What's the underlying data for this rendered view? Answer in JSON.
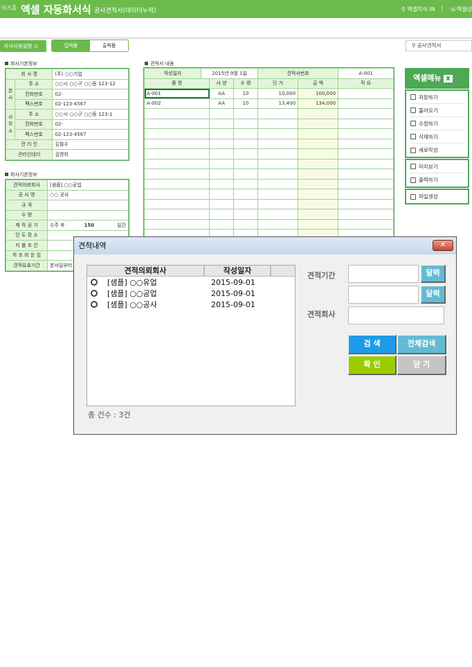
{
  "header": {
    "brand_small": "비즈폼",
    "brand": "엑셀 자동화서식",
    "subtitle": "공사견적서(데이터누적)",
    "knowledge": "엑셀지식 IN",
    "sep": "|",
    "consult": "엑셀상담"
  },
  "toolbar": {
    "guide": "서식사용설명",
    "tab_input": "입력폼",
    "tab_output": "출력폼",
    "search": "공사견적서"
  },
  "company": {
    "section": "회사기본정보",
    "name_label": "회 사 명",
    "name": "(주) ○○기업",
    "hq_label": "본 사",
    "office_label": "사 무 소",
    "addr_label": "주 소",
    "phone_label": "전화번호",
    "fax_label": "팩스번호",
    "hq_addr": "○○시 ○○구 ○○동 123-12",
    "hq_phone": "02-",
    "hq_fax": "02-123-4567",
    "of_addr": "○○시 ○○구 ○○동 123-1",
    "of_phone": "02-",
    "of_fax": "02-123-4567",
    "mgr_label": "관 리 인",
    "mgr": "김철수",
    "deputy_label": "관리인대리",
    "deputy": "김영희"
  },
  "project": {
    "section": "회사기본정보",
    "rows": [
      {
        "label": "견적의뢰회사",
        "value": "[샘플] ○○공업"
      },
      {
        "label": "공 사 명",
        "value": "○○ 공사"
      },
      {
        "label": "규 격",
        "value": ""
      },
      {
        "label": "수 량",
        "value": ""
      },
      {
        "label": "제 작 공 기",
        "value": "수주 후",
        "num": "150",
        "unit": "일간"
      },
      {
        "label": "인 도 장 소",
        "value": ""
      },
      {
        "label": "지 불 조 건",
        "value": ""
      },
      {
        "label": "하 조 비 운 임",
        "value": ""
      },
      {
        "label": "견적유효기간",
        "value": "본서일부터"
      }
    ]
  },
  "estimate": {
    "section": "견적서 내용",
    "date_label": "작성일자",
    "date": "2015년 9월 1일",
    "no_label": "견적서번호",
    "no": "A-001",
    "headers": [
      "품 명",
      "사 양",
      "수 량",
      "단 가",
      "금 액",
      "적 요"
    ],
    "rows": [
      [
        "A-001",
        "AA",
        "10",
        "10,000",
        "100,000",
        ""
      ],
      [
        "A-002",
        "AA",
        "10",
        "13,400",
        "134,000",
        ""
      ]
    ]
  },
  "menu": {
    "title": "엑셀메뉴",
    "items": [
      "저장하기",
      "불러오기",
      "수정하기",
      "삭제하기",
      "새로작성"
    ],
    "items2": [
      "미리보기",
      "출력하기"
    ],
    "items3": [
      "파일생성"
    ]
  },
  "dialog": {
    "title": "견적내역",
    "close": "✕",
    "col_company": "견적의뢰회사",
    "col_date": "작성일자",
    "rows": [
      {
        "company": "[샘플] ○○유업",
        "date": "2015-09-01"
      },
      {
        "company": "[샘플] ○○공업",
        "date": "2015-09-01"
      },
      {
        "company": "[샘플] ○○공사",
        "date": "2015-09-01"
      }
    ],
    "total": "총 건수 : 3건",
    "period_label": "견적기간",
    "company_label": "견적회사",
    "calendar": "달력",
    "search": "검 색",
    "search_all": "전체검색",
    "ok": "확 인",
    "close_btn": "닫 기",
    "colors": {
      "search": "#1e9be8",
      "search_all": "#62bbd4",
      "ok": "#9ccc00",
      "close": "#c4c4c4"
    }
  }
}
